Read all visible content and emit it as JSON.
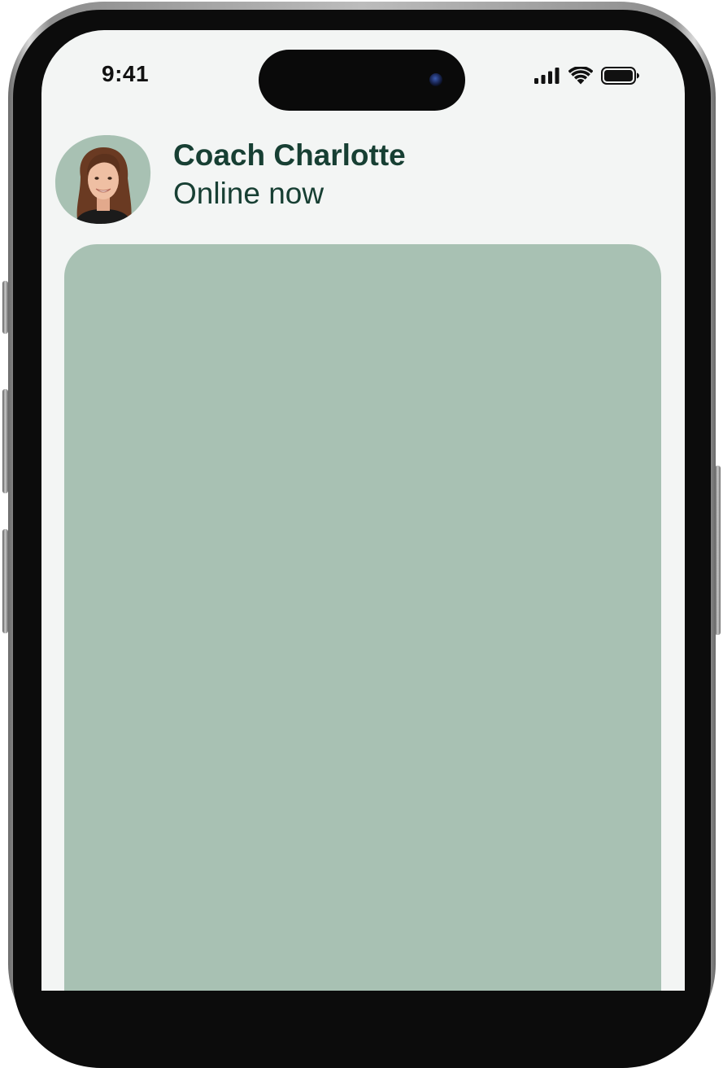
{
  "status_bar": {
    "time": "9:41",
    "signal_icon": "cellular-signal-icon",
    "wifi_icon": "wifi-icon",
    "battery_icon": "battery-icon"
  },
  "chat_header": {
    "avatar_icon": "coach-avatar",
    "name": "Coach Charlotte",
    "status": "Online now"
  },
  "colors": {
    "screen_background": "#f3f5f4",
    "text_primary": "#173f33",
    "card_background": "#a8c1b3",
    "avatar_blob": "#a8c1b3"
  }
}
